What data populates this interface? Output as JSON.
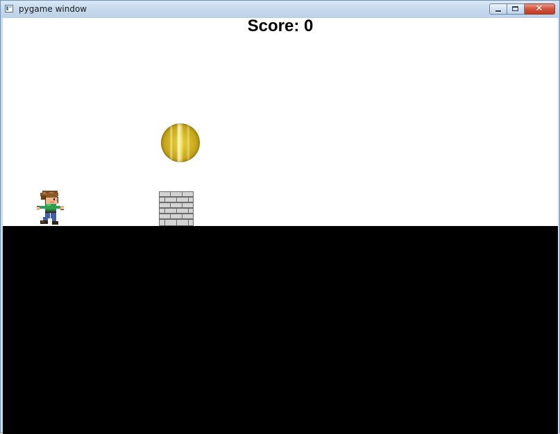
{
  "window": {
    "title": "pygame window",
    "controls": {
      "minimize_icon": "minimize-icon",
      "maximize_icon": "maximize-icon",
      "close_icon": "close-icon",
      "close_glyph": "✕"
    },
    "accent_close": "#c84a32",
    "frame_color": "#c9dcef"
  },
  "game": {
    "score_text": "Score: 0",
    "background_color": "#ffffff",
    "ground_color": "#000000",
    "sprites": {
      "player": "running-boy-sprite",
      "coin": "gold-coin",
      "obstacle": "brick-block"
    }
  }
}
